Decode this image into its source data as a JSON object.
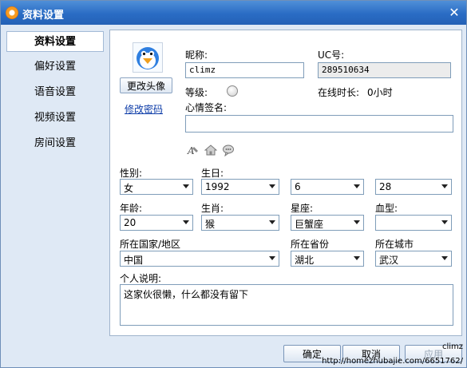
{
  "window": {
    "title": "资料设置",
    "close_glyph": "✕"
  },
  "sidebar": {
    "items": [
      {
        "label": "资料设置",
        "active": true
      },
      {
        "label": "偏好设置",
        "active": false
      },
      {
        "label": "语音设置",
        "active": false
      },
      {
        "label": "视频设置",
        "active": false
      },
      {
        "label": "房间设置",
        "active": false
      }
    ]
  },
  "profile": {
    "change_avatar_label": "更改头像",
    "change_password_label": "修改密码",
    "nickname_label": "昵称:",
    "nickname_value": "climz",
    "uc_label": "UC号:",
    "uc_value": "289510634",
    "level_label": "等级:",
    "online_label": "在线时长:",
    "online_value": "0小时",
    "mood_label": "心情签名:",
    "mood_value": ""
  },
  "fields": {
    "gender": {
      "label": "性别:",
      "value": "女"
    },
    "birthday": {
      "label": "生日:",
      "year": "1992",
      "month": "6",
      "day": "28"
    },
    "age": {
      "label": "年龄:",
      "value": "20"
    },
    "zodiac": {
      "label": "生肖:",
      "value": "猴"
    },
    "constellation": {
      "label": "星座:",
      "value": "巨蟹座"
    },
    "blood": {
      "label": "血型:",
      "value": ""
    },
    "country": {
      "label": "所在国家/地区",
      "value": "中国"
    },
    "province": {
      "label": "所在省份",
      "value": "湖北"
    },
    "city": {
      "label": "所在城市",
      "value": "武汉"
    }
  },
  "description": {
    "label": "个人说明:",
    "value": "这家伙很懒，什么都没有留下"
  },
  "buttons": {
    "ok": "确定",
    "cancel": "取消",
    "apply": "应用"
  },
  "watermark": {
    "user": "climz",
    "url": "http://homezhubajie.com/6651762/"
  },
  "colors": {
    "title_bar": "#2a6cc4",
    "panel_border": "#9fb4cc",
    "link": "#0d3ca8"
  }
}
